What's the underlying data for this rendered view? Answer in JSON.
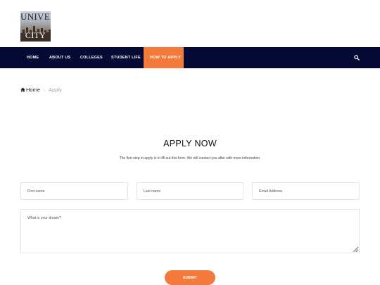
{
  "logo": {
    "line1": "UNIVER",
    "line2": "CITY"
  },
  "nav": {
    "items": [
      {
        "label": "HOME"
      },
      {
        "label": "ABOUT US"
      },
      {
        "label": "COLLEGES"
      },
      {
        "label": "STUDENT LIFE"
      },
      {
        "label": "HOW TO APPLY"
      }
    ]
  },
  "breadcrumb": {
    "home": "Home",
    "separator": "›",
    "current": "Apply"
  },
  "page": {
    "title": "APPLY NOW",
    "subtitle": "The first step to apply is to fill out this form. We will contact you after with more information."
  },
  "form": {
    "first_name_placeholder": "First name",
    "last_name_placeholder": "Last name",
    "email_placeholder": "Email Address",
    "dream_placeholder": "What is your dream?",
    "submit_label": "SUBMIT"
  },
  "colors": {
    "nav_bg": "#050a35",
    "accent": "#f47a3b"
  }
}
